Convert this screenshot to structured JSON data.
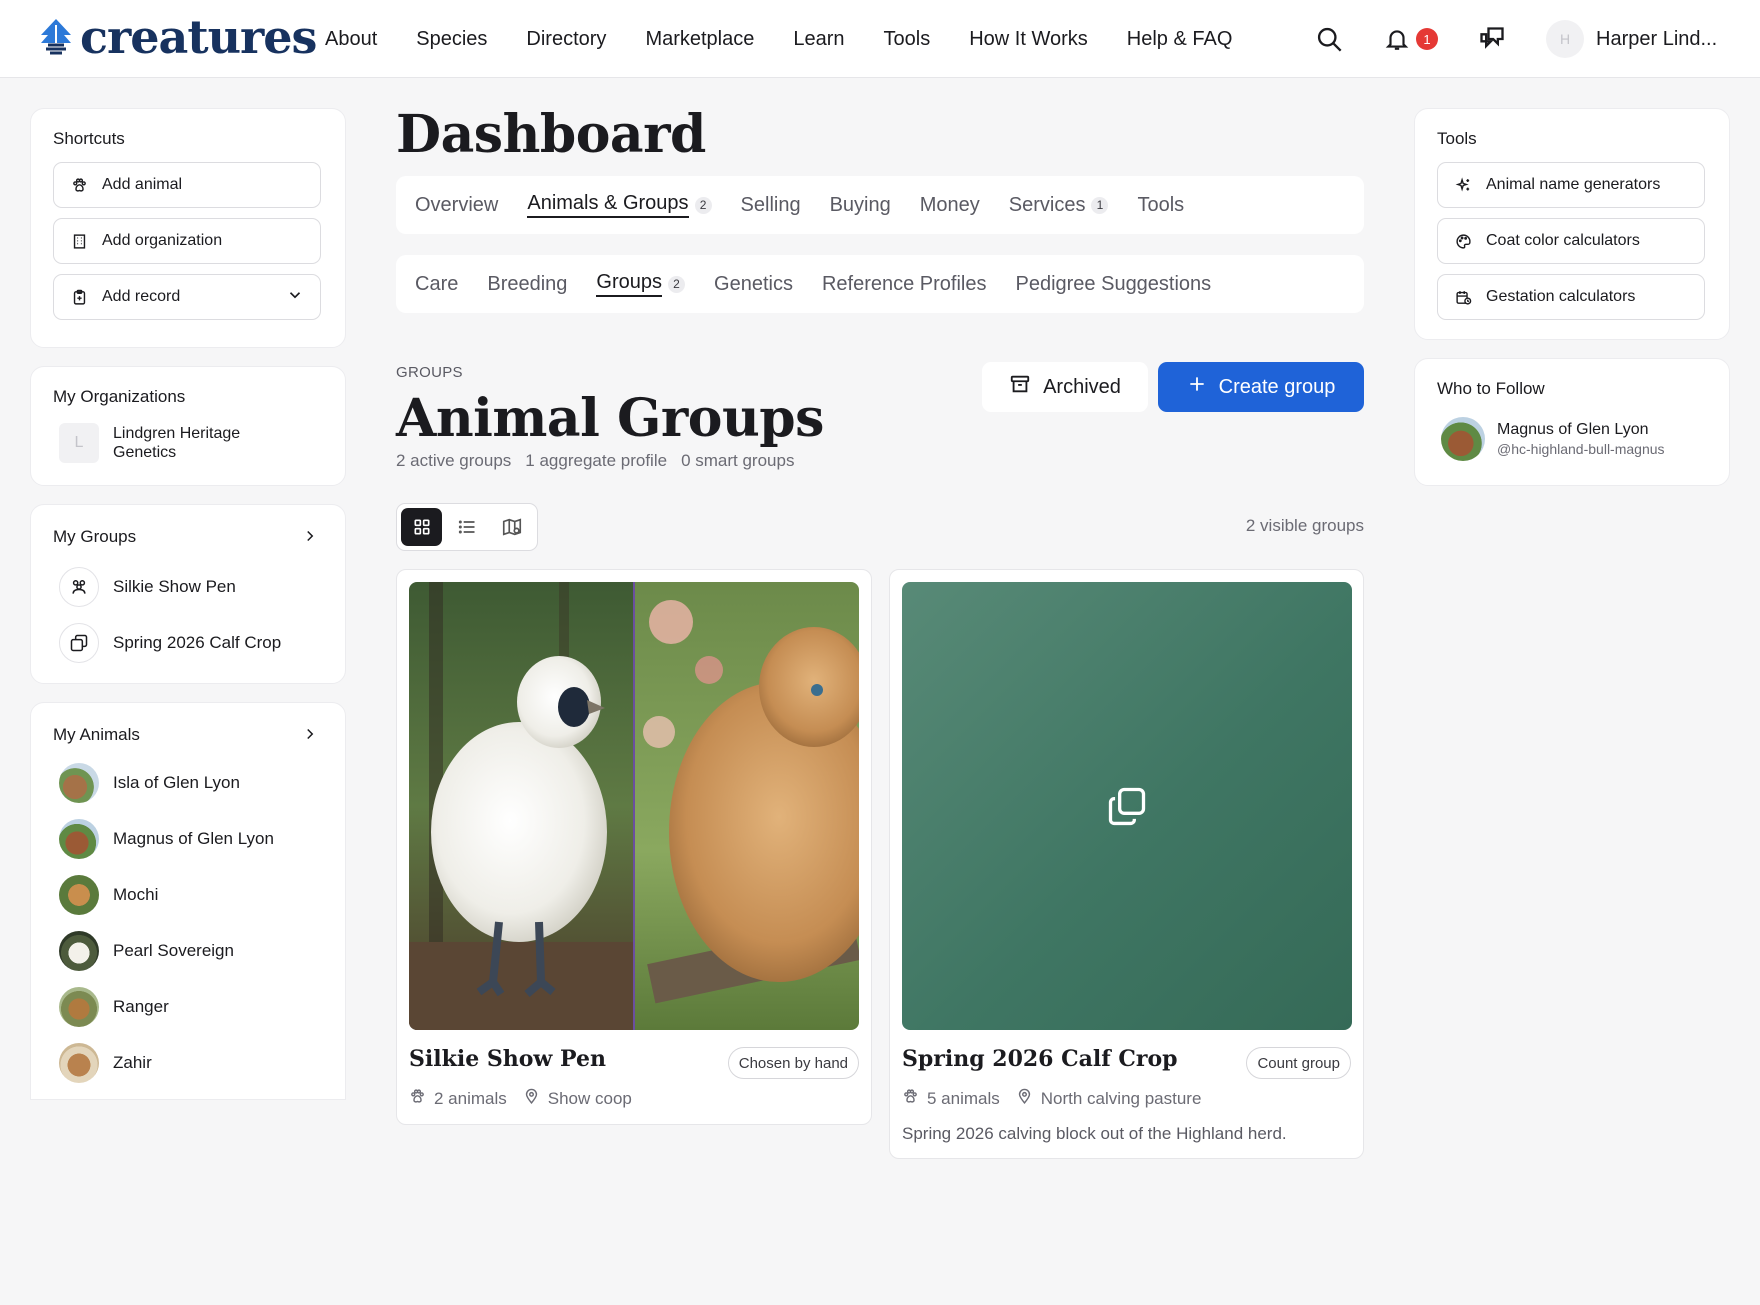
{
  "brand": {
    "name": "creatures"
  },
  "nav": [
    "About",
    "Species",
    "Directory",
    "Marketplace",
    "Learn",
    "Tools",
    "How It Works",
    "Help & FAQ"
  ],
  "header": {
    "notification_count": "1",
    "user_initial": "H",
    "user_name": "Harper Lind..."
  },
  "shortcuts": {
    "title": "Shortcuts",
    "items": [
      {
        "label": "Add animal",
        "icon": "paw-icon"
      },
      {
        "label": "Add organization",
        "icon": "building-icon"
      },
      {
        "label": "Add record",
        "icon": "clipboard-icon"
      }
    ]
  },
  "organizations": {
    "title": "My Organizations",
    "items": [
      {
        "initial": "L",
        "name": "Lindgren Heritage Genetics"
      }
    ]
  },
  "groups_sidebar": {
    "title": "My Groups",
    "items": [
      {
        "name": "Silkie Show Pen"
      },
      {
        "name": "Spring 2026 Calf Crop"
      }
    ]
  },
  "animals_sidebar": {
    "title": "My Animals",
    "items": [
      "Isla of Glen Lyon",
      "Magnus of Glen Lyon",
      "Mochi",
      "Pearl Sovereign",
      "Ranger",
      "Zahir"
    ]
  },
  "main": {
    "title": "Dashboard",
    "tabs": [
      {
        "label": "Overview"
      },
      {
        "label": "Animals & Groups",
        "count": "2",
        "active": true
      },
      {
        "label": "Selling"
      },
      {
        "label": "Buying"
      },
      {
        "label": "Money"
      },
      {
        "label": "Services",
        "count": "1"
      },
      {
        "label": "Tools"
      }
    ],
    "subtabs": [
      {
        "label": "Care"
      },
      {
        "label": "Breeding"
      },
      {
        "label": "Groups",
        "count": "2",
        "active": true
      },
      {
        "label": "Genetics"
      },
      {
        "label": "Reference Profiles"
      },
      {
        "label": "Pedigree Suggestions"
      }
    ],
    "eyebrow": "GROUPS",
    "section_title": "Animal Groups",
    "stats": [
      "2 active groups",
      "1 aggregate profile",
      "0 smart groups"
    ],
    "archived_label": "Archived",
    "create_label": "Create group",
    "visible_count": "2 visible groups",
    "groups": [
      {
        "name": "Silkie Show Pen",
        "tag": "Chosen by hand",
        "animals": "2 animals",
        "location": "Show coop",
        "description": ""
      },
      {
        "name": "Spring 2026 Calf Crop",
        "tag": "Count group",
        "animals": "5 animals",
        "location": "North calving pasture",
        "description": "Spring 2026 calving block out of the Highland herd."
      }
    ]
  },
  "tools": {
    "title": "Tools",
    "items": [
      {
        "label": "Animal name generators",
        "icon": "sparkle-icon"
      },
      {
        "label": "Coat color calculators",
        "icon": "palette-icon"
      },
      {
        "label": "Gestation calculators",
        "icon": "calendar-icon"
      }
    ]
  },
  "who_to_follow": {
    "title": "Who to Follow",
    "items": [
      {
        "name": "Magnus of Glen Lyon",
        "handle": "@hc-highland-bull-magnus"
      }
    ]
  },
  "colors": {
    "accent": "#1f63d8",
    "brand": "#17325f",
    "badge": "#e53935",
    "calf_card": "#3f7663"
  }
}
